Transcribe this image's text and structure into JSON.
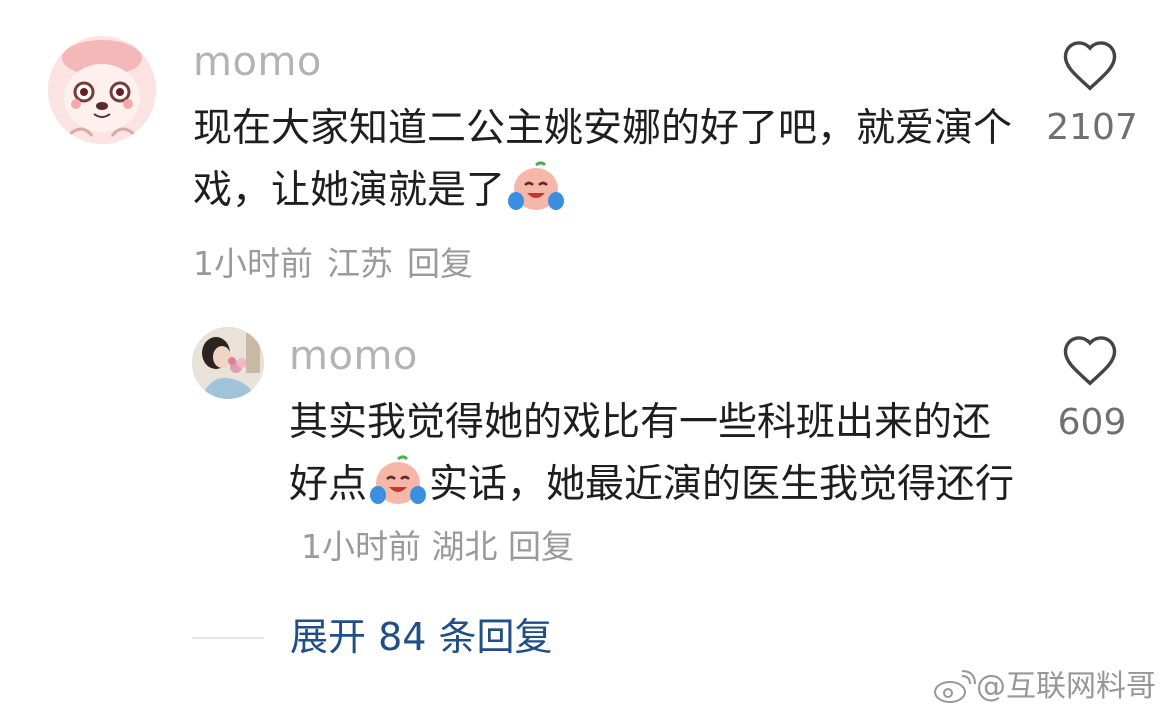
{
  "comment": {
    "username": "momo",
    "text": "现在大家知道二公主姚安娜的好了吧，就爱演个戏，让她演就是了",
    "emoji": "crying-laughing-face",
    "time": "1小时前",
    "location": "江苏",
    "reply_label": "回复",
    "likes": "2107"
  },
  "reply": {
    "username": "momo",
    "text_part1": "其实我觉得她的戏比有一些科班出来的还好点",
    "emoji": "crying-laughing-face",
    "text_part2": "实话，她最近演的医生我觉得还行",
    "time": "1小时前",
    "location": "湖北",
    "reply_label": "回复",
    "likes": "609"
  },
  "expand": {
    "label": "展开 84 条回复"
  },
  "watermark": {
    "text": "@互联网料哥"
  },
  "colors": {
    "link_blue": "#1f4f86",
    "meta_gray": "#9a9a9a",
    "username_gray": "#b3b3b3"
  }
}
